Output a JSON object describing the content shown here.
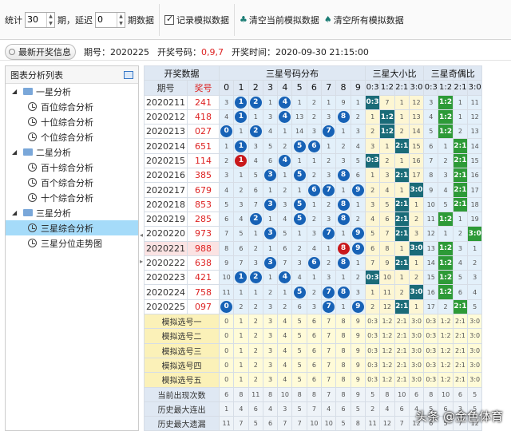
{
  "toolbar": {
    "stat_label": "统计",
    "periods_value": "30",
    "period_unit": "期，延迟",
    "delay_value": "0",
    "delay_unit": "期数据",
    "record_label": "记录模拟数据",
    "clear_current": "清空当前模拟数据",
    "clear_all": "清空所有模拟数据"
  },
  "info": {
    "latest_btn": "最新开奖信息",
    "period_label": "期号：",
    "period": "2020225",
    "draw_label": "开奖号码：",
    "draw_numbers": "0,9,7",
    "time_label": "开奖时间：",
    "time": "2020-09-30 21:15:00"
  },
  "tree": {
    "title": "图表分析列表",
    "groups": [
      {
        "label": "一星分析",
        "items": [
          "百位综合分析",
          "十位综合分析",
          "个位综合分析"
        ]
      },
      {
        "label": "二星分析",
        "items": [
          "百十综合分析",
          "百个综合分析",
          "十个综合分析"
        ]
      },
      {
        "label": "三星分析",
        "items": [
          "三星综合分析",
          "三星分位走势图"
        ]
      }
    ],
    "selected": "三星综合分析"
  },
  "grid": {
    "headers": {
      "draw_data": "开奖数据",
      "dist": "三星号码分布",
      "size": "三星大小比",
      "parity": "三星奇偶比",
      "period": "期号",
      "number": "奖号",
      "digits": [
        "0",
        "1",
        "2",
        "3",
        "4",
        "5",
        "6",
        "7",
        "8",
        "9"
      ],
      "ratios": [
        "0:3",
        "1:2",
        "2:1",
        "3:0"
      ]
    },
    "rows": [
      {
        "period": "2020211",
        "num": "241",
        "d": [
          "3",
          "1",
          "2",
          "1",
          "4",
          "1",
          "2",
          "1",
          "9",
          "1"
        ],
        "s": [
          "0:3",
          "7",
          "1",
          "12"
        ],
        "p": [
          "3",
          "1:2",
          "1",
          "11"
        ]
      },
      {
        "period": "2020212",
        "num": "418",
        "d": [
          "4",
          "1",
          "1",
          "3",
          "4",
          "13",
          "2",
          "3",
          "8",
          "2"
        ],
        "s": [
          "1",
          "1:2",
          "1",
          "13"
        ],
        "p": [
          "4",
          "1:2",
          "1",
          "12"
        ]
      },
      {
        "period": "2020213",
        "num": "027",
        "d": [
          "0",
          "1",
          "2",
          "4",
          "1",
          "14",
          "3",
          "7",
          "1",
          "3"
        ],
        "s": [
          "2",
          "1:2",
          "2",
          "14"
        ],
        "p": [
          "5",
          "1:2",
          "2",
          "13"
        ]
      },
      {
        "period": "2020214",
        "num": "651",
        "d": [
          "1",
          "1",
          "3",
          "5",
          "2",
          "5",
          "6",
          "1",
          "2",
          "4"
        ],
        "s": [
          "3",
          "1",
          "2:1",
          "15"
        ],
        "p": [
          "6",
          "1",
          "2:1",
          "14"
        ]
      },
      {
        "period": "2020215",
        "num": "114",
        "d": [
          "2",
          "1",
          "4",
          "6",
          "4",
          "1",
          "1",
          "2",
          "3",
          "5"
        ],
        "s": [
          "0:3",
          "2",
          "1",
          "16"
        ],
        "p": [
          "7",
          "2",
          "2:1",
          "15"
        ]
      },
      {
        "period": "2020216",
        "num": "385",
        "d": [
          "3",
          "1",
          "5",
          "3",
          "1",
          "5",
          "2",
          "3",
          "8",
          "6"
        ],
        "s": [
          "1",
          "3",
          "2:1",
          "17"
        ],
        "p": [
          "8",
          "3",
          "2:1",
          "16"
        ]
      },
      {
        "period": "2020217",
        "num": "679",
        "d": [
          "4",
          "2",
          "6",
          "1",
          "2",
          "1",
          "6",
          "7",
          "1",
          "9"
        ],
        "s": [
          "2",
          "4",
          "1",
          "3:0"
        ],
        "p": [
          "9",
          "4",
          "2:1",
          "17"
        ]
      },
      {
        "period": "2020218",
        "num": "853",
        "d": [
          "5",
          "3",
          "7",
          "3",
          "3",
          "5",
          "1",
          "2",
          "8",
          "1"
        ],
        "s": [
          "3",
          "5",
          "2:1",
          "1"
        ],
        "p": [
          "10",
          "5",
          "2:1",
          "18"
        ]
      },
      {
        "period": "2020219",
        "num": "285",
        "d": [
          "6",
          "4",
          "2",
          "1",
          "4",
          "5",
          "2",
          "3",
          "8",
          "2"
        ],
        "s": [
          "4",
          "6",
          "2:1",
          "2"
        ],
        "p": [
          "11",
          "1:2",
          "1",
          "19"
        ]
      },
      {
        "period": "2020220",
        "num": "973",
        "d": [
          "7",
          "5",
          "1",
          "3",
          "5",
          "1",
          "3",
          "7",
          "1",
          "9"
        ],
        "s": [
          "5",
          "7",
          "2:1",
          "3"
        ],
        "p": [
          "12",
          "1",
          "2",
          "3:0"
        ]
      },
      {
        "period": "2020221",
        "num": "988",
        "d": [
          "8",
          "6",
          "2",
          "1",
          "6",
          "2",
          "4",
          "1",
          "8",
          "9"
        ],
        "s": [
          "6",
          "8",
          "1",
          "3:0"
        ],
        "p": [
          "13",
          "1:2",
          "3",
          "1"
        ]
      },
      {
        "period": "2020222",
        "num": "638",
        "d": [
          "9",
          "7",
          "3",
          "3",
          "7",
          "3",
          "6",
          "2",
          "8",
          "1"
        ],
        "s": [
          "7",
          "9",
          "2:1",
          "1"
        ],
        "p": [
          "14",
          "1:2",
          "4",
          "2"
        ]
      },
      {
        "period": "2020223",
        "num": "421",
        "d": [
          "10",
          "1",
          "2",
          "1",
          "4",
          "4",
          "1",
          "3",
          "1",
          "2"
        ],
        "s": [
          "0:3",
          "10",
          "1",
          "2"
        ],
        "p": [
          "15",
          "1:2",
          "5",
          "3"
        ]
      },
      {
        "period": "2020224",
        "num": "758",
        "d": [
          "11",
          "1",
          "1",
          "2",
          "1",
          "5",
          "2",
          "7",
          "8",
          "3"
        ],
        "s": [
          "1",
          "11",
          "2",
          "3:0"
        ],
        "p": [
          "16",
          "1:2",
          "6",
          "4"
        ]
      },
      {
        "period": "2020225",
        "num": "097",
        "d": [
          "0",
          "2",
          "2",
          "3",
          "2",
          "6",
          "3",
          "7",
          "1",
          "9"
        ],
        "s": [
          "2",
          "12",
          "2:1",
          "1"
        ],
        "p": [
          "17",
          "2",
          "2:1",
          "5"
        ]
      }
    ],
    "sim_rows": [
      "模拟选号一",
      "模拟选号二",
      "模拟选号三",
      "模拟选号四",
      "模拟选号五"
    ],
    "stat_rows": [
      {
        "label": "当前出现次数",
        "vals": [
          "6",
          "8",
          "11",
          "8",
          "10",
          "8",
          "8",
          "7",
          "8",
          "9",
          "5",
          "8",
          "10",
          "6",
          "8",
          "10",
          "6",
          "5"
        ]
      },
      {
        "label": "历史最大连出",
        "vals": [
          "1",
          "4",
          "6",
          "4",
          "3",
          "5",
          "7",
          "4",
          "6",
          "5",
          "2",
          "4",
          "6",
          "4",
          "5",
          "6",
          "3",
          "5"
        ]
      },
      {
        "label": "历史最大遗漏",
        "vals": [
          "11",
          "7",
          "5",
          "6",
          "7",
          "7",
          "10",
          "10",
          "5",
          "8",
          "11",
          "12",
          "7",
          "12",
          "6",
          "5",
          "7",
          "12"
        ]
      }
    ]
  },
  "watermark": "头条 @金色体育"
}
